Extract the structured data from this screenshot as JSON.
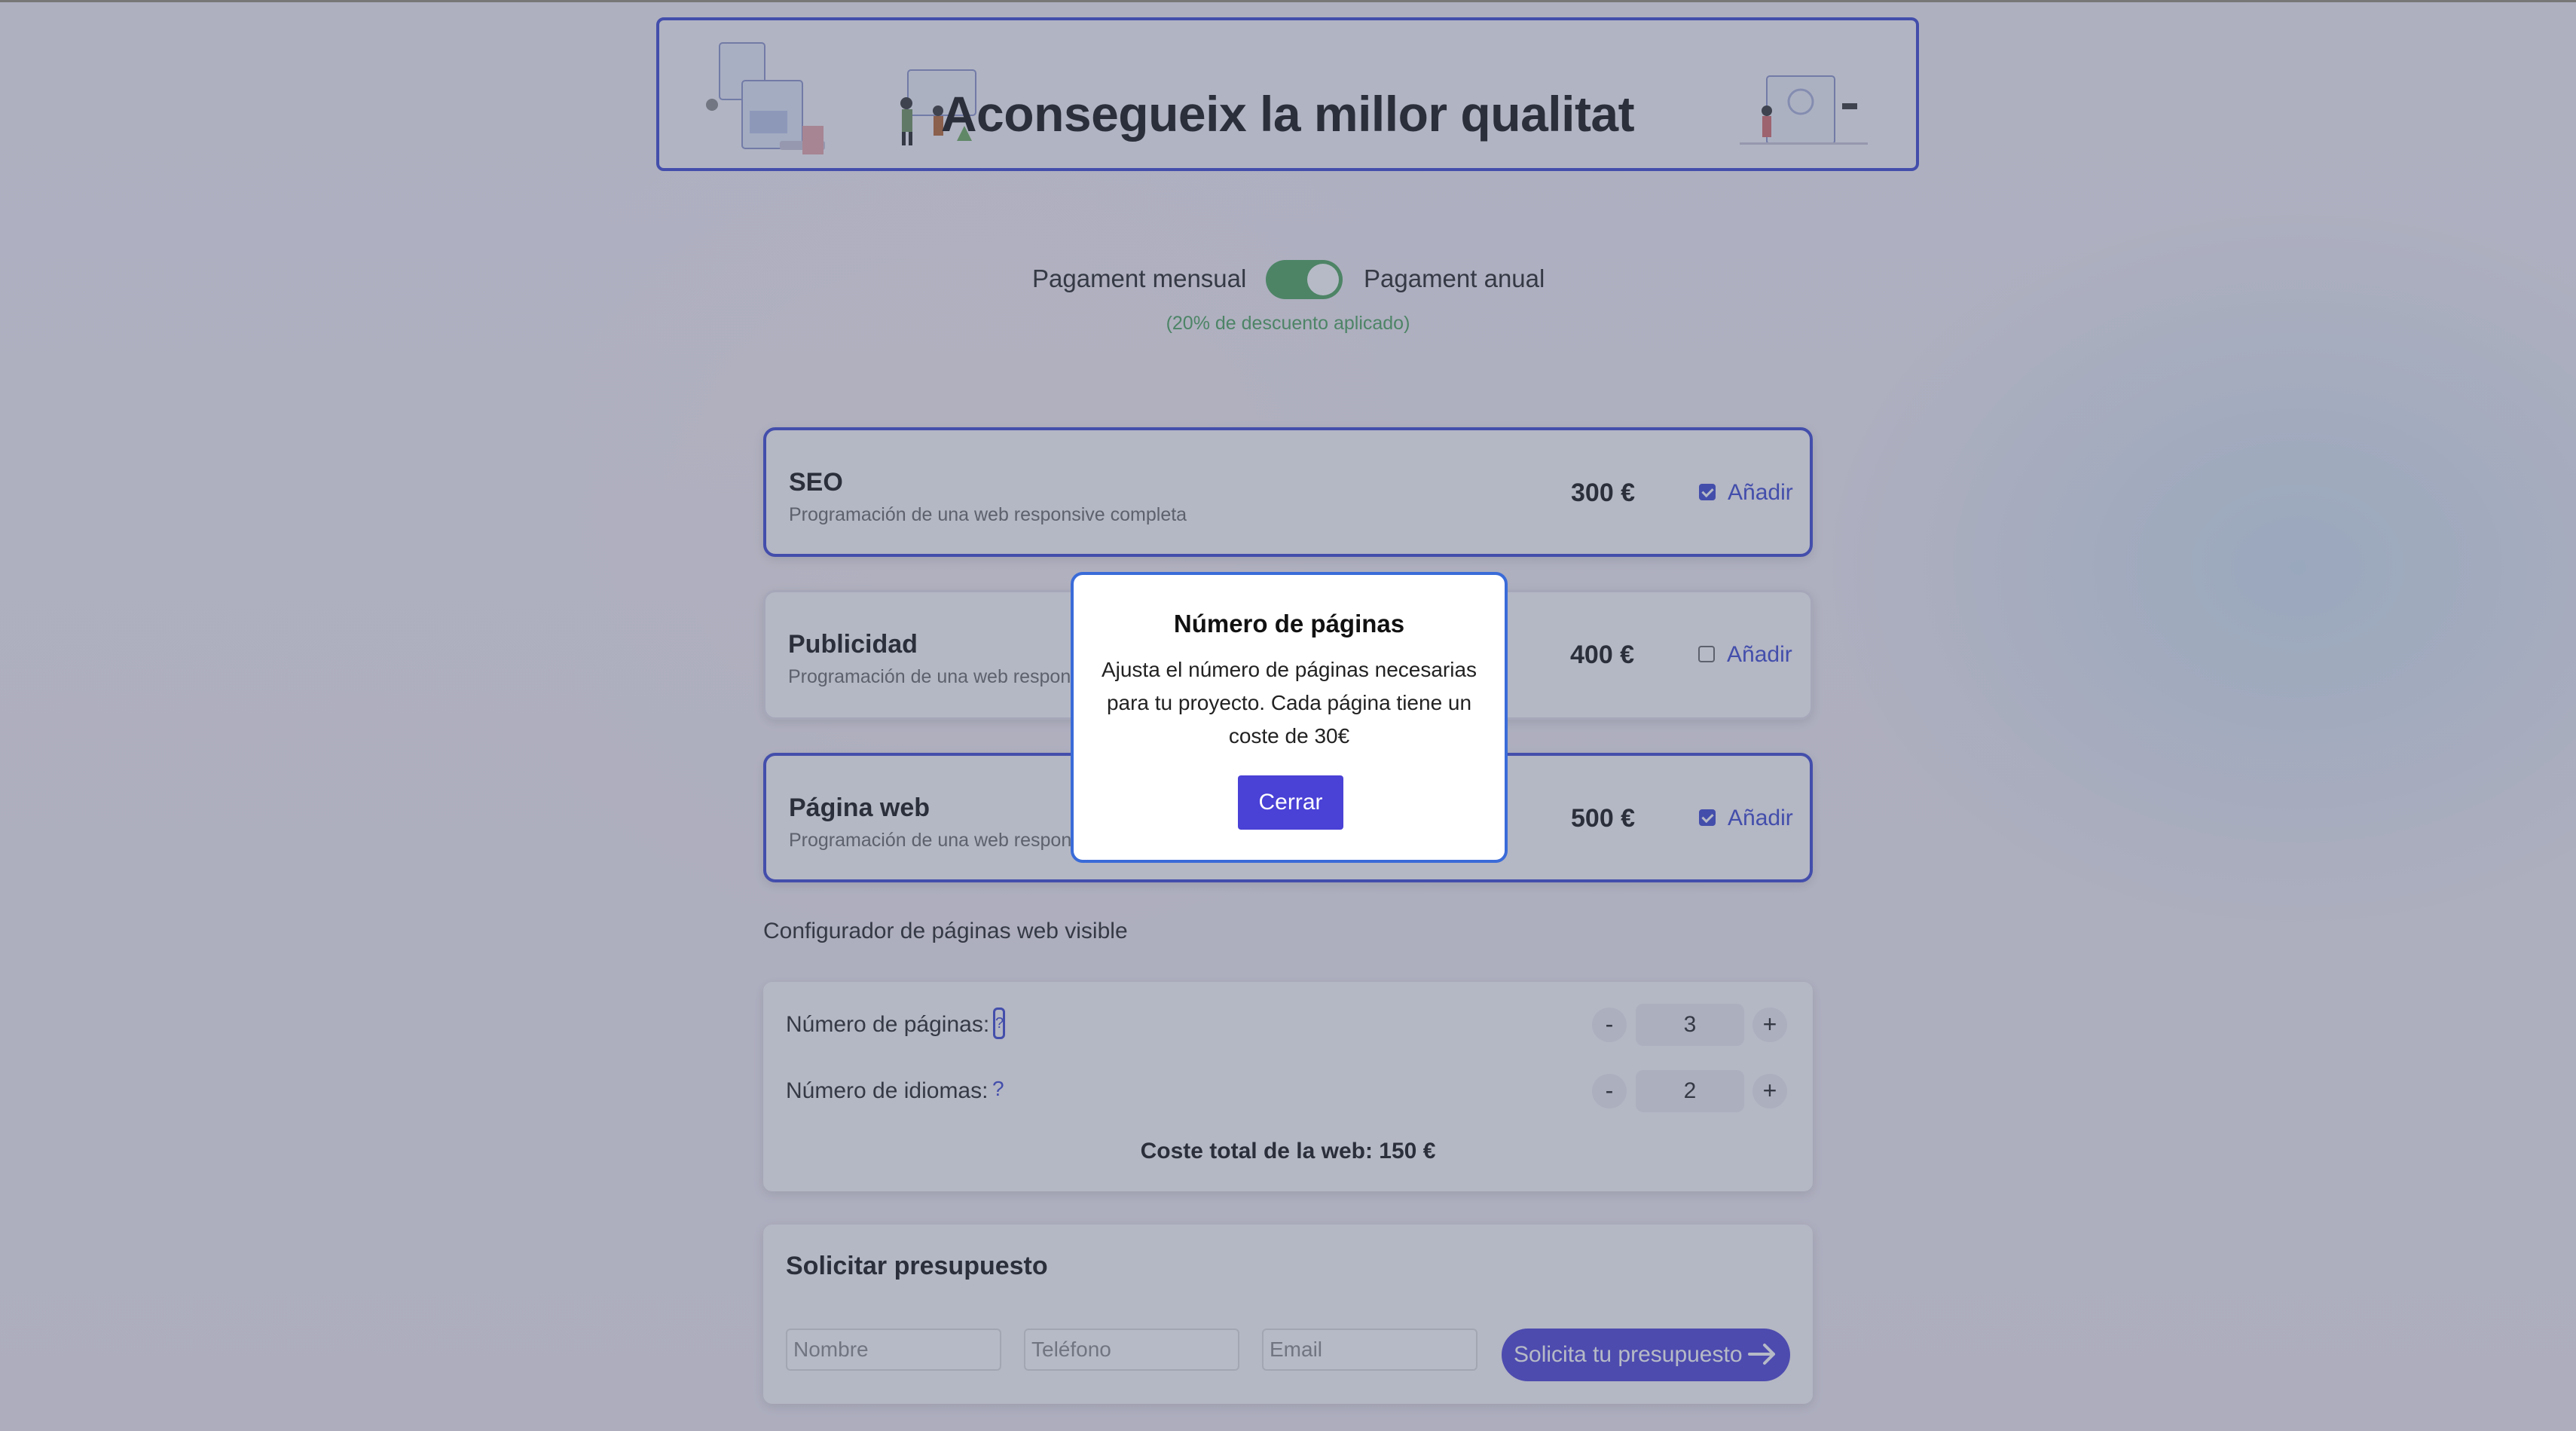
{
  "banner": {
    "title": "Aconsegueix la millor qualitat"
  },
  "payment": {
    "monthly_label": "Pagament mensual",
    "annual_label": "Pagament anual",
    "toggle_on": true,
    "discount_note": "(20% de descuento aplicado)",
    "accent_color": "#4aa35b"
  },
  "services": [
    {
      "title": "SEO",
      "description": "Programación de una web responsive completa",
      "price": "300 €",
      "add_label": "Añadir",
      "checked": true
    },
    {
      "title": "Publicidad",
      "description": "Programación de una web responsive completa",
      "price": "400 €",
      "add_label": "Añadir",
      "checked": false
    },
    {
      "title": "Página web",
      "description": "Programación de una web responsive completa",
      "price": "500 €",
      "add_label": "Añadir",
      "checked": true
    }
  ],
  "configurator": {
    "visible_text": "Configurador de páginas web visible",
    "pages_label": "Número de páginas:",
    "pages_value": "3",
    "languages_label": "Número de idiomas:",
    "languages_value": "2",
    "help_glyph": "?",
    "minus": "-",
    "plus": "+",
    "total_text": "Coste total de la web: 150 €"
  },
  "quote": {
    "title": "Solicitar presupuesto",
    "name_placeholder": "Nombre",
    "phone_placeholder": "Teléfono",
    "email_placeholder": "Email",
    "submit_label": "Solicita tu presupuesto"
  },
  "modal": {
    "title": "Número de páginas",
    "body": "Ajusta el número de páginas necesarias para tu proyecto. Cada página tiene un coste de 30€",
    "close_label": "Cerrar"
  },
  "colors": {
    "brand": "#3a45d0",
    "button": "#4a41d6"
  }
}
